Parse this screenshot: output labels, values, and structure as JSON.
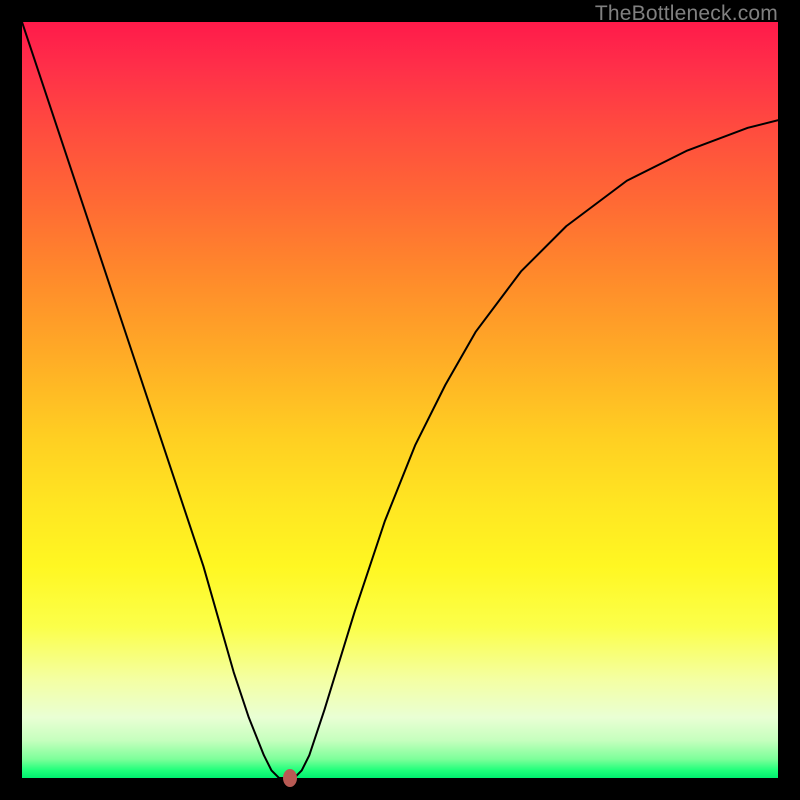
{
  "watermark": "TheBottleneck.com",
  "colors": {
    "frame": "#000000",
    "curve": "#000000",
    "marker": "#b85a54",
    "watermark": "#808080"
  },
  "chart_data": {
    "type": "line",
    "title": "",
    "xlabel": "",
    "ylabel": "",
    "xlim": [
      0,
      100
    ],
    "ylim": [
      0,
      100
    ],
    "grid": false,
    "legend": false,
    "annotations": [],
    "series": [
      {
        "name": "bottleneck-curve",
        "x": [
          0,
          4,
          8,
          12,
          16,
          20,
          24,
          28,
          30,
          32,
          33,
          34,
          35,
          36,
          37,
          38,
          40,
          44,
          48,
          52,
          56,
          60,
          66,
          72,
          80,
          88,
          96,
          100
        ],
        "y": [
          100,
          88,
          76,
          64,
          52,
          40,
          28,
          14,
          8,
          3,
          1,
          0,
          0,
          0,
          1,
          3,
          9,
          22,
          34,
          44,
          52,
          59,
          67,
          73,
          79,
          83,
          86,
          87
        ]
      }
    ],
    "marker": {
      "x": 35.5,
      "y": 0
    },
    "background_gradient": {
      "top": "#ff1a4a",
      "mid": "#ffe622",
      "bottom": "#00ef6f"
    }
  }
}
